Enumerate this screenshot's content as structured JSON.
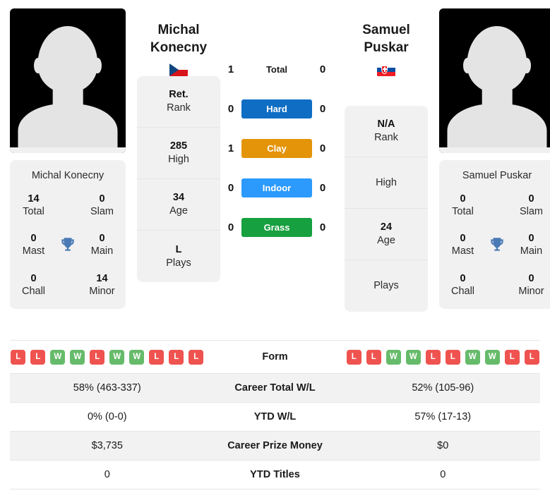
{
  "players": {
    "left": {
      "first_name": "Michal",
      "last_name": "Konecny",
      "full_name": "Michal Konecny",
      "country_flag": "czech-republic-flag",
      "avatar": "player-placeholder-silhouette",
      "titles": {
        "total_value": "14",
        "total_label": "Total",
        "slam_value": "0",
        "slam_label": "Slam",
        "mast_value": "0",
        "mast_label": "Mast",
        "main_value": "0",
        "main_label": "Main",
        "chall_value": "0",
        "chall_label": "Chall",
        "minor_value": "14",
        "minor_label": "Minor"
      },
      "info": {
        "rank_value": "Ret.",
        "rank_label": "Rank",
        "high_value": "285",
        "high_label": "High",
        "age_value": "34",
        "age_label": "Age",
        "plays_value": "L",
        "plays_label": "Plays"
      },
      "form": [
        "L",
        "L",
        "W",
        "W",
        "L",
        "W",
        "W",
        "L",
        "L",
        "L"
      ],
      "career_total_wl": "58% (463-337)",
      "ytd_wl": "0% (0-0)",
      "career_prize_money": "$3,735",
      "ytd_titles": "0"
    },
    "right": {
      "first_name": "Samuel",
      "last_name": "Puskar",
      "full_name": "Samuel Puskar",
      "country_flag": "slovakia-flag",
      "avatar": "player-placeholder-silhouette",
      "titles": {
        "total_value": "0",
        "total_label": "Total",
        "slam_value": "0",
        "slam_label": "Slam",
        "mast_value": "0",
        "mast_label": "Mast",
        "main_value": "0",
        "main_label": "Main",
        "chall_value": "0",
        "chall_label": "Chall",
        "minor_value": "0",
        "minor_label": "Minor"
      },
      "info": {
        "rank_value": "N/A",
        "rank_label": "Rank",
        "high_value": "",
        "high_label": "High",
        "age_value": "24",
        "age_label": "Age",
        "plays_value": "",
        "plays_label": "Plays"
      },
      "form": [
        "L",
        "L",
        "W",
        "W",
        "L",
        "L",
        "W",
        "W",
        "L",
        "L"
      ],
      "career_total_wl": "52% (105-96)",
      "ytd_wl": "57% (17-13)",
      "career_prize_money": "$0",
      "ytd_titles": "0"
    }
  },
  "head_to_head": {
    "total": {
      "label": "Total",
      "left_score": "1",
      "right_score": "0"
    },
    "surfaces": [
      {
        "label": "Hard",
        "color": "#0f6ec4",
        "left_score": "0",
        "right_score": "0"
      },
      {
        "label": "Clay",
        "color": "#e39409",
        "left_score": "1",
        "right_score": "0"
      },
      {
        "label": "Indoor",
        "color": "#2b9afc",
        "left_score": "0",
        "right_score": "0"
      },
      {
        "label": "Grass",
        "color": "#17a03f",
        "left_score": "0",
        "right_score": "0"
      }
    ]
  },
  "stats_rows": {
    "form_label": "Form",
    "career_total_wl_label": "Career Total W/L",
    "ytd_wl_label": "YTD W/L",
    "career_prize_money_label": "Career Prize Money",
    "ytd_titles_label": "YTD Titles"
  },
  "theme": {
    "trophy_color": "#4a7ab5",
    "win_color": "#66bb6a",
    "loss_color": "#ef5350",
    "card_bg": "#f1f1f1",
    "stripe_bg": "#f2f2f2"
  }
}
